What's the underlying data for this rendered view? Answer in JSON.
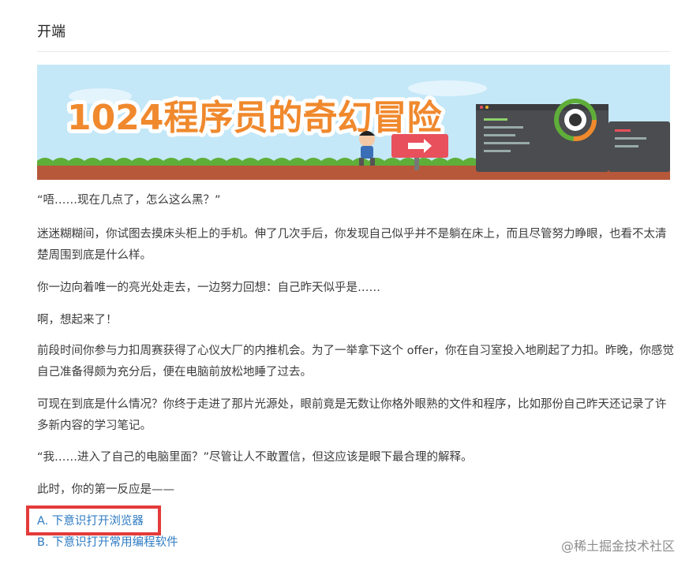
{
  "header": {
    "title": "开端"
  },
  "banner": {
    "title": "1024程序员的奇幻冒险"
  },
  "paragraphs": [
    "“唔……现在几点了，怎么这么黑？”",
    "迷迷糊糊间，你试图去摸床头柜上的手机。伸了几次手后，你发现自己似乎并不是躺在床上，而且尽管努力睁眼，也看不太清楚周围到底是什么样。",
    "你一边向着唯一的亮光处走去，一边努力回想：自己昨天似乎是……",
    "啊，想起来了！",
    "前段时间你参与力扣周赛获得了心仪大厂的内推机会。为了一举拿下这个 offer，你在自习室投入地刷起了力扣。昨晚，你感觉自己准备得颇为充分后，便在电脑前放松地睡了过去。",
    "可现在到底是什么情况？你终于走进了那片光源处，眼前竟是无数让你格外眼熟的文件和程序，比如那份自己昨天还记录了许多新内容的学习笔记。",
    "“我……进入了自己的电脑里面？”尽管让人不敢置信，但这应该是眼下最合理的解释。",
    "此时，你的第一反应是——"
  ],
  "choices": [
    {
      "label": "A. 下意识打开浏览器"
    },
    {
      "label": "B. 下意识打开常用编程软件"
    }
  ],
  "watermark": "@稀土掘金技术社区",
  "colors": {
    "link": "#2e7bc4",
    "highlight": "#e53a3a",
    "title_orange": "#f0892e"
  }
}
